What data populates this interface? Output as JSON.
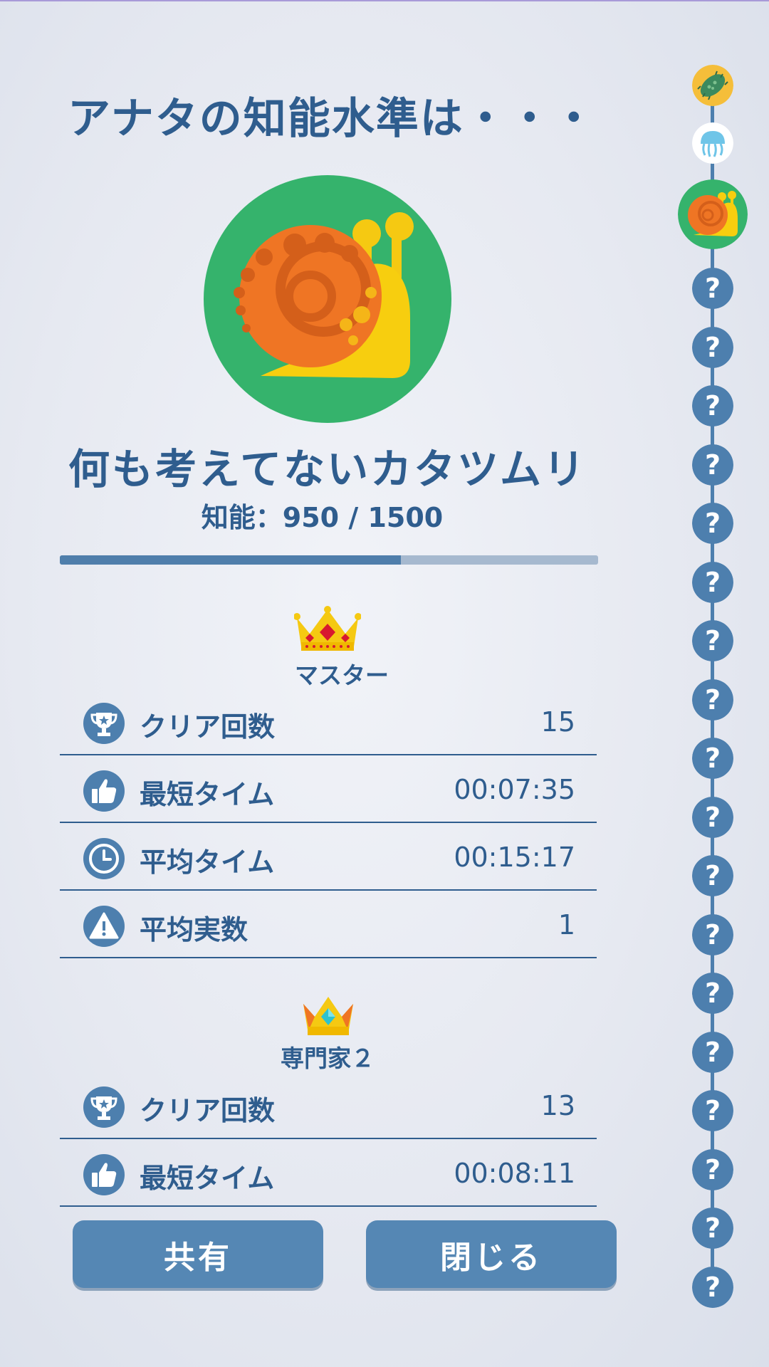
{
  "header": {
    "title": "アナタの知能水準は・・・"
  },
  "result": {
    "rank_name": "何も考えてないカタツムリ",
    "iq_text": "知能：950 / 1500",
    "iq_value": 950,
    "iq_max": 1500,
    "hero_icon": "snail-icon"
  },
  "sections": [
    {
      "difficulty": "マスター",
      "crown_icon": "crown-red-gem-icon",
      "stats": [
        {
          "icon": "trophy-icon",
          "label": "クリア回数",
          "value": "15"
        },
        {
          "icon": "thumbs-up-icon",
          "label": "最短タイム",
          "value": "00:07:35"
        },
        {
          "icon": "clock-icon",
          "label": "平均タイム",
          "value": "00:15:17"
        },
        {
          "icon": "warning-icon",
          "label": "平均実数",
          "value": "1"
        }
      ]
    },
    {
      "difficulty": "専門家２",
      "crown_icon": "crown-blue-gem-icon",
      "stats": [
        {
          "icon": "trophy-icon",
          "label": "クリア回数",
          "value": "13"
        },
        {
          "icon": "thumbs-up-icon",
          "label": "最短タイム",
          "value": "00:08:11"
        }
      ]
    }
  ],
  "buttons": {
    "share": "共有",
    "close": "閉じる"
  },
  "timeline": {
    "unlocked": [
      "bacteria-icon",
      "jellyfish-icon",
      "snail-icon"
    ],
    "unknown_glyph": "?"
  },
  "colors": {
    "primary": "#2f5d8e",
    "button": "#5587b4",
    "progress_fill": "#4f7eab",
    "progress_track": "#a6b9cf",
    "hero_bg": "#35b36c"
  }
}
